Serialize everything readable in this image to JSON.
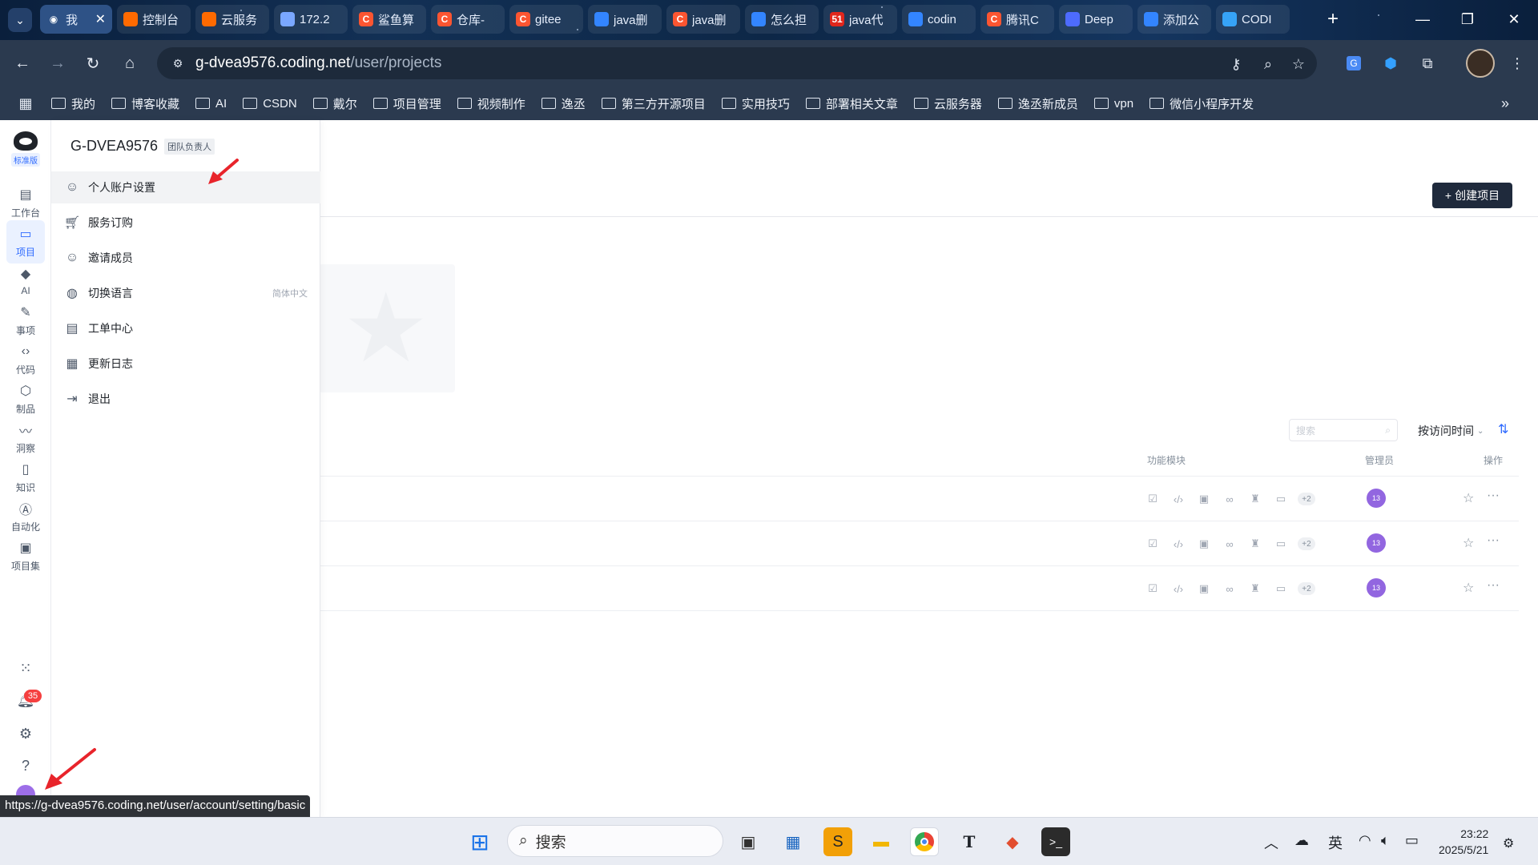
{
  "browser": {
    "tabs": [
      {
        "title": "我",
        "favicon": "coding-logo-icon",
        "color": "#ffffff",
        "active": true
      },
      {
        "title": "控制台",
        "favicon": "aliyun-icon",
        "color": "#ff6a00"
      },
      {
        "title": "云服务",
        "favicon": "aliyun-icon",
        "color": "#ff6a00"
      },
      {
        "title": "172.2",
        "favicon": "remote-desktop-icon",
        "color": "#7aa7ff"
      },
      {
        "title": "鲨鱼算",
        "favicon": "csdn-icon",
        "color": "#fc5531"
      },
      {
        "title": "仓库-",
        "favicon": "csdn-icon",
        "color": "#fc5531"
      },
      {
        "title": "gitee",
        "favicon": "csdn-icon",
        "color": "#fc5531"
      },
      {
        "title": "java删",
        "favicon": "baidu-icon",
        "color": "#3385ff"
      },
      {
        "title": "java删",
        "favicon": "csdn-icon",
        "color": "#fc5531"
      },
      {
        "title": "怎么担",
        "favicon": "baidu-icon",
        "color": "#3385ff"
      },
      {
        "title": "java代",
        "favicon": "51cto-icon",
        "color": "#e1261c"
      },
      {
        "title": "codin",
        "favicon": "baidu-icon",
        "color": "#3385ff"
      },
      {
        "title": "腾讯C",
        "favicon": "csdn-icon",
        "color": "#fc5531"
      },
      {
        "title": "Deep",
        "favicon": "deepseek-icon",
        "color": "#4d6bfe"
      },
      {
        "title": "添加公",
        "favicon": "baidu-icon",
        "color": "#3385ff"
      },
      {
        "title": "CODI",
        "favicon": "coding-cloud-icon",
        "color": "#36a3f7"
      }
    ],
    "url_host": "g-dvea9576.coding.net",
    "url_path": "/user/projects",
    "bookmarks": [
      "我的",
      "博客收藏",
      "AI",
      "CSDN",
      "戴尔",
      "项目管理",
      "视频制作",
      "逸丞",
      "第三方开源项目",
      "实用技巧",
      "部署相关文章",
      "云服务器",
      "逸丞新成员",
      "vpn",
      "微信小程序开发"
    ],
    "status_url": "https://g-dvea9576.coding.net/user/account/setting/basic"
  },
  "leftnav": {
    "plan": "标准版",
    "items": [
      "工作台",
      "项目",
      "AI",
      "事项",
      "代码",
      "制品",
      "洞察",
      "知识",
      "自动化",
      "项目集"
    ],
    "notification_count": "35"
  },
  "drawer": {
    "team_name": "G-DVEA9576",
    "team_role": "团队负责人",
    "items": [
      "个人账户设置",
      "服务订购",
      "邀请成员",
      "切换语言",
      "工单中心",
      "更新日志",
      "退出"
    ],
    "language_value": "简体中文"
  },
  "main": {
    "create_button": "创建项目",
    "search_placeholder": "搜索",
    "sort_label": "按访问时间",
    "columns": {
      "modules": "功能模块",
      "admin": "管理员",
      "actions": "操作"
    },
    "rows": [
      {
        "more_modules": "+2",
        "admin_initials": "13"
      },
      {
        "more_modules": "+2",
        "admin_initials": "13"
      },
      {
        "more_modules": "+2",
        "admin_initials": "13"
      }
    ]
  },
  "taskbar": {
    "search_label": "搜索",
    "ime": "英",
    "time": "23:22",
    "date": "2025/5/21"
  },
  "colors": {
    "accent": "#2f6bff",
    "create_button": "#1f2a3c",
    "annotation_arrow": "#e8242b"
  }
}
